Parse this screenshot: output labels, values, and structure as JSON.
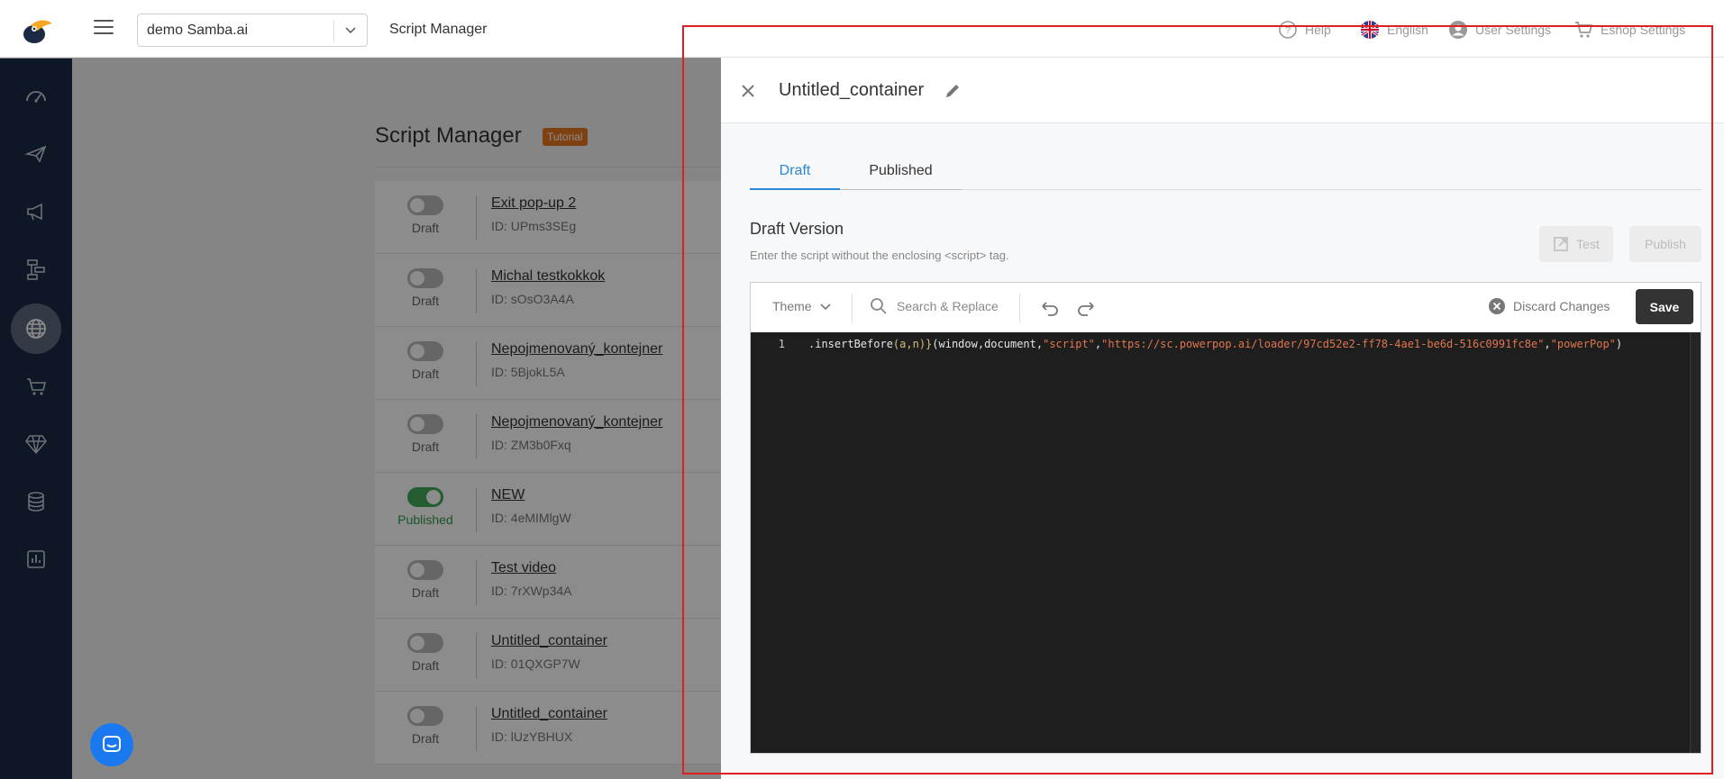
{
  "header": {
    "shop_select_value": "demo Samba.ai",
    "page_title": "Script Manager",
    "help_label": "Help",
    "language_label": "English",
    "user_settings_label": "User Settings",
    "eshop_settings_label": "Eshop Settings"
  },
  "sidebar": {
    "items": [
      {
        "icon": "dashboard-icon"
      },
      {
        "icon": "campaign-icon"
      },
      {
        "icon": "megaphone-icon"
      },
      {
        "icon": "workflow-icon"
      },
      {
        "icon": "globe-icon",
        "active": true
      },
      {
        "icon": "cart-icon"
      },
      {
        "icon": "diamond-icon"
      },
      {
        "icon": "database-icon"
      },
      {
        "icon": "report-icon"
      }
    ]
  },
  "script_manager": {
    "title": "Script Manager",
    "tutorial_badge": "Tutorial",
    "scripts": [
      {
        "name": "Exit pop-up 2",
        "id": "ID: UPms3SEg",
        "status": "Draft",
        "on": false
      },
      {
        "name": "Michal testkokkok",
        "id": "ID: sOsO3A4A",
        "status": "Draft",
        "on": false
      },
      {
        "name": "Nepojmenovaný_kontejner",
        "id": "ID: 5BjokL5A",
        "status": "Draft",
        "on": false
      },
      {
        "name": "Nepojmenovaný_kontejner",
        "id": "ID: ZM3b0Fxq",
        "status": "Draft",
        "on": false
      },
      {
        "name": "NEW",
        "id": "ID: 4eMIMlgW",
        "status": "Published",
        "on": true
      },
      {
        "name": "Test video",
        "id": "ID: 7rXWp34A",
        "status": "Draft",
        "on": false
      },
      {
        "name": "Untitled_container",
        "id": "ID: 01QXGP7W",
        "status": "Draft",
        "on": false
      },
      {
        "name": "Untitled_container",
        "id": "ID: lUzYBHUX",
        "status": "Draft",
        "on": false
      }
    ]
  },
  "drawer": {
    "title": "Untitled_container",
    "tabs": [
      {
        "label": "Draft",
        "active": true
      },
      {
        "label": "Published",
        "active": false
      }
    ],
    "section_title": "Draft Version",
    "section_subtitle": "Enter the script without the enclosing <script> tag.",
    "test_label": "Test",
    "publish_label": "Publish",
    "toolbar": {
      "theme_label": "Theme",
      "search_label": "Search & Replace",
      "discard_label": "Discard Changes",
      "save_label": "Save"
    },
    "code": {
      "line_number": "1",
      "fn_part": ".insertBefore",
      "args_part": "(a,n)",
      "brace_part": "}",
      "call_open": "(window,document,",
      "str_script": "\"script\"",
      "comma1": ",",
      "str_url": "\"https://sc.powerpop.ai/loader/97cd52e2-ff78-4ae1-be6d-516c0991fc8e\"",
      "comma2": ",",
      "str_name": "\"powerPop\"",
      "call_close": ")"
    }
  },
  "colors": {
    "sidebar_bg": "#1b2a44",
    "accent_blue": "#2b87d1",
    "tutorial_orange": "#e8771c",
    "published_green": "#3ea856",
    "highlight_red": "#e02020"
  }
}
